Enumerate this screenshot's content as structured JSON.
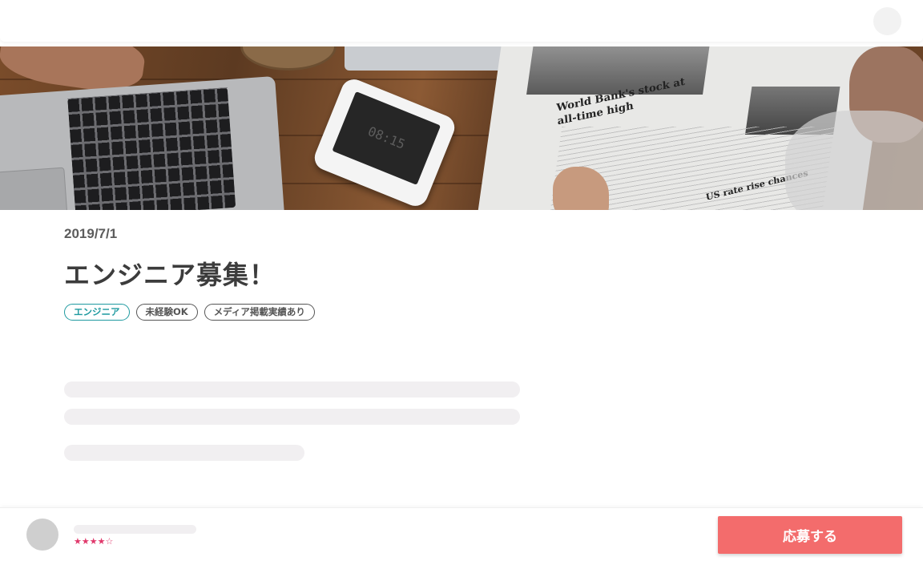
{
  "header": {
    "avatar_icon": "user-avatar-placeholder"
  },
  "hero": {
    "description_icon": "hero-photo",
    "phone_screen_text": "08:15",
    "newspaper_headline": "World Bank's stock at all-time high",
    "newspaper_subheadline": "US rate rise chances"
  },
  "post": {
    "date": "2019/7/1",
    "title": "エンジニア募集！",
    "tags": [
      {
        "label": "エンジニア",
        "color": "#1f9aa0"
      },
      {
        "label": "未経験OK",
        "color": "#555555"
      },
      {
        "label": "メディア掲載実績あり",
        "color": "#555555"
      }
    ]
  },
  "footer": {
    "rating_stars": "★★★★☆",
    "rating_value": 4,
    "rating_max": 5,
    "apply_label": "応募する",
    "apply_color": "#f36c6c"
  }
}
